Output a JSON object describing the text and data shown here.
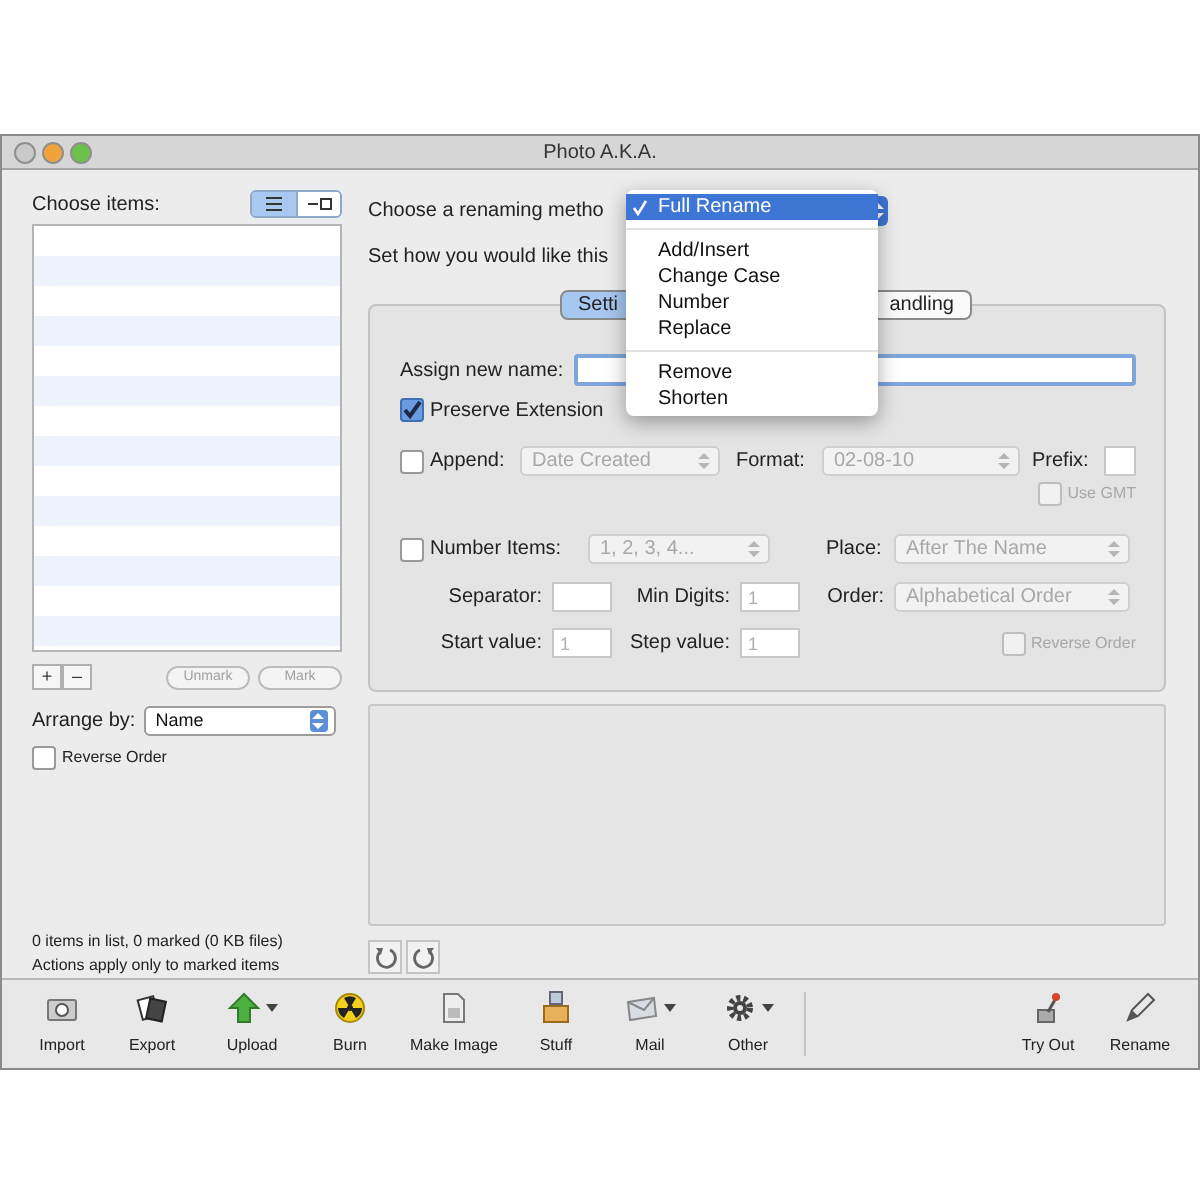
{
  "window": {
    "title": "Photo A.K.A."
  },
  "left": {
    "label": "Choose items:",
    "view_toggle": [
      {
        "selected": true
      },
      {
        "selected": false
      }
    ],
    "list_buttons": [
      {
        "label": "+",
        "disabled": false
      },
      {
        "label": "–",
        "disabled": false
      }
    ],
    "mark_buttons": [
      {
        "label": "Unmark",
        "disabled": true
      },
      {
        "label": "Mark",
        "disabled": true
      }
    ],
    "arrange": {
      "label": "Arrange by:",
      "value": "Name"
    },
    "reverse_order": {
      "label": "Reverse Order",
      "checked": false
    },
    "status": [
      "0 items in list, 0 marked (0 KB files)",
      "Actions apply only to marked items"
    ]
  },
  "method": {
    "label": "Choose a renaming metho",
    "menu": [
      [
        {
          "label": "Full Rename",
          "selected": true
        }
      ],
      [
        {
          "label": "Add/Insert",
          "selected": false
        },
        {
          "label": "Change Case",
          "selected": false
        },
        {
          "label": "Number",
          "selected": false
        },
        {
          "label": "Replace",
          "selected": false
        }
      ],
      [
        {
          "label": "Remove",
          "selected": false
        },
        {
          "label": "Shorten",
          "selected": false
        }
      ]
    ]
  },
  "hint": "Set how you would like this",
  "tabs": [
    {
      "label": "Setti",
      "selected": true
    },
    {
      "label": "andling",
      "selected": false
    }
  ],
  "settings": {
    "assign_label": "Assign new name:",
    "preserve": {
      "label": "Preserve Extension",
      "checked": true
    },
    "append": {
      "label": "Append:",
      "checked": false,
      "value": "Date Created",
      "format_label": "Format:",
      "format": "02-08-10",
      "prefix_label": "Prefix:"
    },
    "use_gmt": {
      "label": "Use GMT",
      "checked": false,
      "disabled": true
    },
    "number": {
      "label": "Number Items:",
      "checked": false,
      "value": "1, 2, 3, 4...",
      "place_label": "Place:",
      "place": "After The Name"
    },
    "separator_label": "Separator:",
    "min_digits_label": "Min Digits:",
    "min_digits": "1",
    "order_label": "Order:",
    "order": "Alphabetical Order",
    "start_label": "Start value:",
    "start": "1",
    "step_label": "Step value:",
    "step": "1",
    "reverse": {
      "label": "Reverse Order",
      "checked": false,
      "disabled": true
    }
  },
  "toolbar": {
    "left": [
      {
        "label": "Import",
        "menu": false
      },
      {
        "label": "Export",
        "menu": false
      },
      {
        "label": "Upload",
        "menu": true
      },
      {
        "label": "Burn",
        "menu": false
      },
      {
        "label": "Make Image",
        "menu": false
      },
      {
        "label": "Stuff",
        "menu": false
      },
      {
        "label": "Mail",
        "menu": true
      },
      {
        "label": "Other",
        "menu": true
      }
    ],
    "right": [
      {
        "label": "Try Out",
        "menu": false
      },
      {
        "label": "Rename",
        "menu": false
      }
    ]
  }
}
